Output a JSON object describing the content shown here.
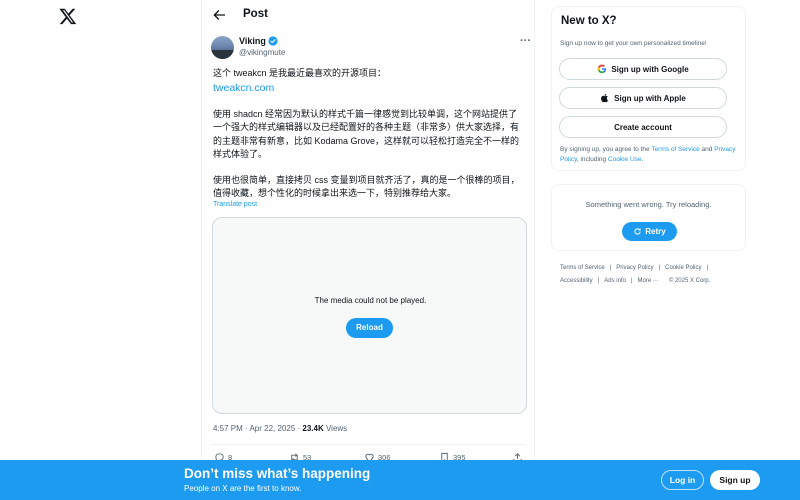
{
  "logo": {
    "icon": "x-logo-icon"
  },
  "header": {
    "title": "Post",
    "back_icon": "arrow-left-icon"
  },
  "tweet": {
    "author_name": "Viking",
    "author_handle": "@vikingmute",
    "verified_icon": "verified-badge-icon",
    "text_line1": "这个 tweakcn 是我最近最喜欢的开源项目：",
    "link": "tweakcn.com",
    "para2": "使用 shadcn 经常因为默认的样式千篇一律感觉到比较单调，这个网站提供了一个强大的样式编辑器以及已经配置好的各种主题（非常多）供大家选择，有的主题非常有新意，比如 Kodama Grove，这样就可以轻松打造完全不一样的样式体验了。",
    "para3": "使用也很简单，直接拷贝 css 变量到项目就齐活了，真的是一个很棒的项目，值得收藏，想个性化的时候拿出来选一下，特别推荐给大家。",
    "translate": "Translate post",
    "media_message": "The media could not be played.",
    "media_reload": "Reload",
    "time": "4:57 PM · Apr 22, 2025 · ",
    "views_count": "23.4K",
    "views_label": " Views",
    "actions": {
      "replies": "8",
      "reposts": "53",
      "likes": "306",
      "bookmarks": "395"
    }
  },
  "sidebar": {
    "new_title": "New to X?",
    "new_sub": "Sign up now to get your own personalized timeline!",
    "google_label": "Sign up with Google",
    "apple_label": "Sign up with Apple",
    "create_label": "Create account",
    "terms_prefix": "By signing up, you agree to the ",
    "terms_link": "Terms of Service",
    "terms_and": " and ",
    "privacy_link": "Privacy Policy",
    "terms_mid": ", including ",
    "cookie_link": "Cookie Use",
    "terms_end": ".",
    "error_msg": "Something went wrong. Try reloading.",
    "retry_label": "Retry"
  },
  "footer": {
    "terms": "Terms of Service",
    "privacy": "Privacy Policy",
    "cookie": "Cookie Policy",
    "accessibility": "Accessibility",
    "ads": "Ads info",
    "more": "More ···",
    "copyright": "© 2025 X Corp."
  },
  "banner": {
    "title": "Don’t miss what’s happening",
    "sub": "People on X are the first to know.",
    "login": "Log in",
    "signup": "Sign up"
  },
  "colors": {
    "accent": "#1d9bf0",
    "text": "#0f1419",
    "muted": "#536471",
    "border": "#eff3f4"
  }
}
